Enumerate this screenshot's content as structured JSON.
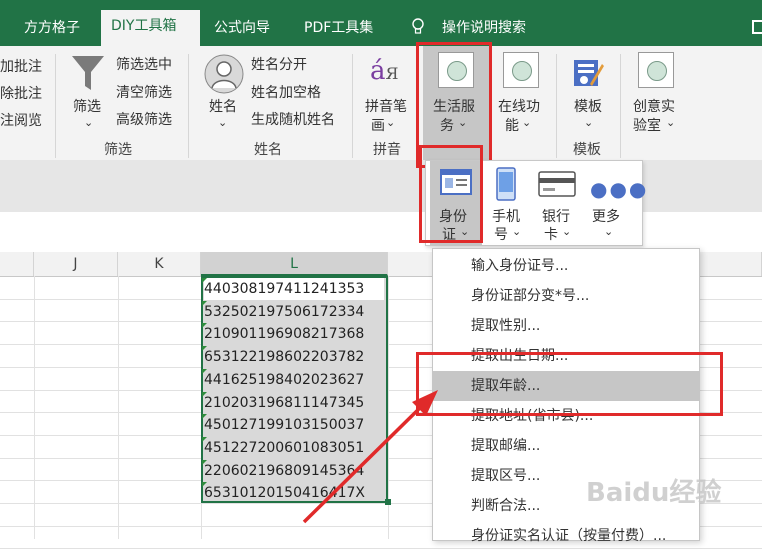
{
  "tabs": [
    {
      "label": "方方格子",
      "active": false
    },
    {
      "label": "DIY工具箱",
      "active": true
    },
    {
      "label": "公式向导",
      "active": false
    },
    {
      "label": "PDF工具集",
      "active": false
    },
    {
      "label": "操作说明搜索",
      "active": false
    }
  ],
  "ribbon": {
    "left_partial": [
      "加批注",
      "除批注",
      "注阅览"
    ],
    "filter_big": "筛选",
    "filter_items": [
      "筛选选中",
      "清空筛选",
      "高级筛选"
    ],
    "filter_group": "筛选",
    "name_big": "姓名",
    "name_items": [
      "姓名分开",
      "姓名加空格",
      "生成随机姓名"
    ],
    "name_group": "姓名",
    "pinyin_big_1": "拼音笔",
    "pinyin_big_2": "画",
    "pinyin_group": "拼音",
    "life_1": "生活服",
    "life_2": "务",
    "online_1": "在线功",
    "online_2": "能",
    "template": "模板",
    "template_group": "模板",
    "creative_1": "创意实",
    "creative_2": "验室"
  },
  "submenu": {
    "idcard_1": "身份",
    "idcard_2": "证",
    "phone_1": "手机",
    "phone_2": "号",
    "bank_1": "银行",
    "bank_2": "卡",
    "more": "更多"
  },
  "columns": {
    "j": "J",
    "k": "K",
    "l": "L"
  },
  "cells": [
    "440308197411241353",
    "532502197506172334",
    "210901196908217368",
    "653122198602203782",
    "441625198402023627",
    "210203196811147345",
    "450127199103150037",
    "451227200601083051",
    "220602196809145364",
    "65310120150416417X"
  ],
  "menu_items": [
    "输入身份证号...",
    "身份证部分变*号...",
    "提取性别...",
    "提取出生日期...",
    "提取年龄...",
    "提取地址(省市县)...",
    "提取邮编...",
    "提取区号...",
    "判断合法...",
    "身份证实名认证（按量付费）..."
  ],
  "highlighted_menu_item": "提取年龄...",
  "watermark": "Baidu经验",
  "colors": {
    "brand": "#217346",
    "highlight_box": "#e02a2a"
  }
}
